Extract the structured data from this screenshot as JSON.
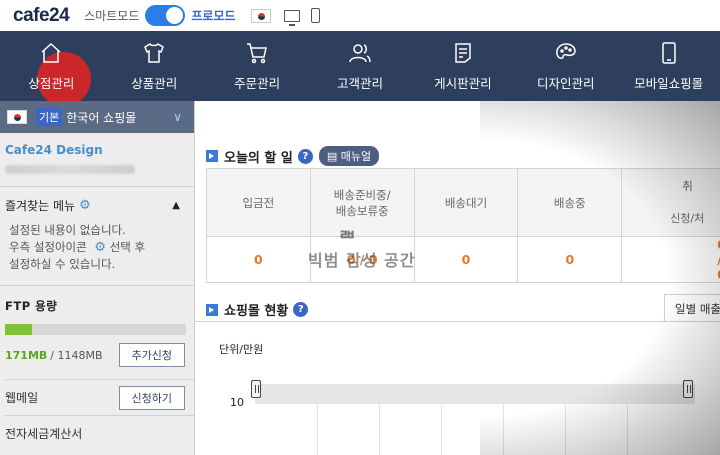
{
  "topbar": {
    "logo": "cafe24",
    "smart_mode_label": "스마트모드",
    "pro_mode_label": "프로모드",
    "toggle_on": true
  },
  "nav": {
    "items": [
      {
        "label": "상점관리",
        "icon": "home-icon",
        "active": true
      },
      {
        "label": "상품관리",
        "icon": "shirt-icon"
      },
      {
        "label": "주문관리",
        "icon": "cart-icon"
      },
      {
        "label": "고객관리",
        "icon": "users-icon"
      },
      {
        "label": "게시판관리",
        "icon": "document-icon"
      },
      {
        "label": "디자인관리",
        "icon": "palette-icon"
      },
      {
        "label": "모바일쇼핑몰",
        "icon": "mobile-icon"
      }
    ]
  },
  "sidebar": {
    "mall_badge": "기본",
    "mall_name": "한국어 쇼핑몰",
    "design_name": "Cafe24 Design",
    "favorites_title": "즐겨찾는 메뉴",
    "favorites_note_1": "설정된 내용이 없습니다.",
    "favorites_note_2a": "우측 설정아이콘",
    "favorites_note_2b": "선택 후",
    "favorites_note_3": "설정하실 수 있습니다.",
    "ftp_title": "FTP 용량",
    "ftp_used": "171MB",
    "ftp_total": "/ 1148MB",
    "ftp_fraction": 0.149,
    "ftp_button": "추가신청",
    "webmail_label": "웹메일",
    "webmail_button": "신청하기",
    "tax_invoice_label": "전자세금계산서"
  },
  "main": {
    "today_title": "오늘의 할 일",
    "manual_label": "매뉴얼",
    "order_headers": [
      {
        "line1": "입금전",
        "line2": ""
      },
      {
        "line1": "배송준비중/",
        "line2": "배송보류중"
      },
      {
        "line1": "배송대기",
        "line2": ""
      },
      {
        "line1": "배송중",
        "line2": ""
      },
      {
        "line1": "취",
        "line2": "신청/처"
      }
    ],
    "order_values": [
      "0",
      "0 / 0",
      "0",
      "0",
      "0 / 0"
    ],
    "watermark_logo": "ᄅᄇ",
    "watermark_text": "빅범 감성 공간",
    "mall_status_title": "쇼핑몰 현황",
    "tab_daily": "일별 매출",
    "unit_label": "단위/만원",
    "y_tick": "10"
  },
  "colors": {
    "nav_bg": "#2d3f5c",
    "accent": "#2b7de9",
    "active_highlight": "#e12323",
    "ftp_fill": "#7cc436",
    "value_orange": "#e8792c"
  }
}
